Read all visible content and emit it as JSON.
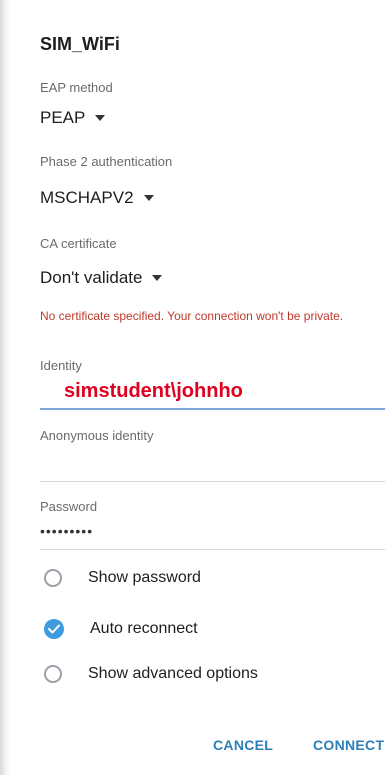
{
  "dialog": {
    "title": "SIM_WiFi"
  },
  "fields": {
    "eap_method": {
      "label": "EAP method",
      "value": "PEAP"
    },
    "phase2": {
      "label": "Phase 2 authentication",
      "value": "MSCHAPV2"
    },
    "ca_certificate": {
      "label": "CA certificate",
      "value": "Don't validate"
    },
    "warning": "No certificate specified. Your connection won't be private.",
    "identity": {
      "label": "Identity",
      "value": "simstudent\\johnho"
    },
    "anonymous_identity": {
      "label": "Anonymous identity",
      "value": ""
    },
    "password": {
      "label": "Password",
      "value": "•••••••••"
    }
  },
  "options": {
    "show_password": {
      "label": "Show password",
      "checked": false
    },
    "auto_reconnect": {
      "label": "Auto reconnect",
      "checked": true
    },
    "show_advanced": {
      "label": "Show advanced options",
      "checked": false
    }
  },
  "buttons": {
    "cancel": "CANCEL",
    "connect": "CONNECT"
  },
  "colors": {
    "accent": "#2c7fb8",
    "check": "#3f9be0",
    "warning": "#c0392b",
    "identity_text": "#e00020"
  }
}
